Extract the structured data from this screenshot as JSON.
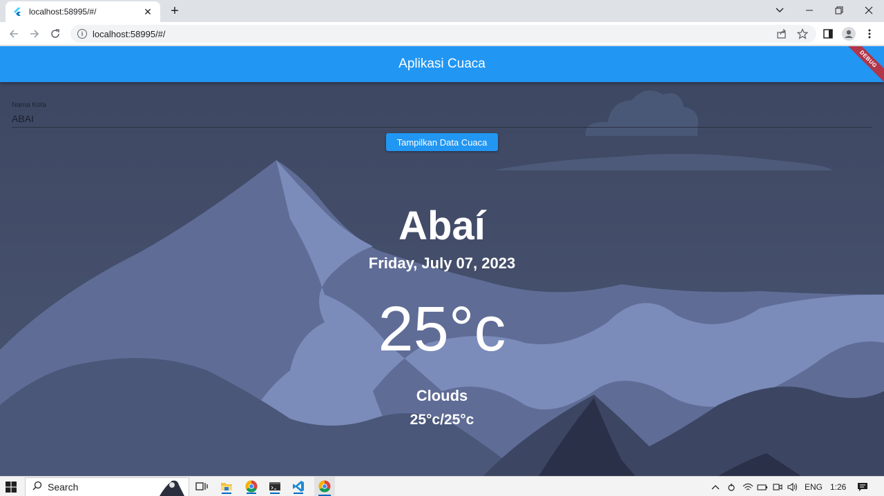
{
  "browser": {
    "tab_title": "localhost:58995/#/",
    "tab_close": "✕",
    "new_tab": "+",
    "url": "localhost:58995/#/"
  },
  "app": {
    "title": "Aplikasi Cuaca",
    "debug_banner": "DEBUG",
    "city_field_label": "Nama Kota",
    "city_field_value": "ABAI",
    "show_button_label": "Tampilkan Data Cuaca",
    "city_name": "Abaí",
    "date": "Friday, July 07, 2023",
    "temperature": "25°c",
    "condition": "Clouds",
    "temp_range": "25°c/25°c",
    "colors": {
      "appbar": "#2196f3",
      "button": "#2196f3",
      "debug": "#b1364a",
      "sky": "#3d4660"
    }
  },
  "taskbar": {
    "search_label": "Search",
    "language": "ENG",
    "time": "1:26"
  }
}
